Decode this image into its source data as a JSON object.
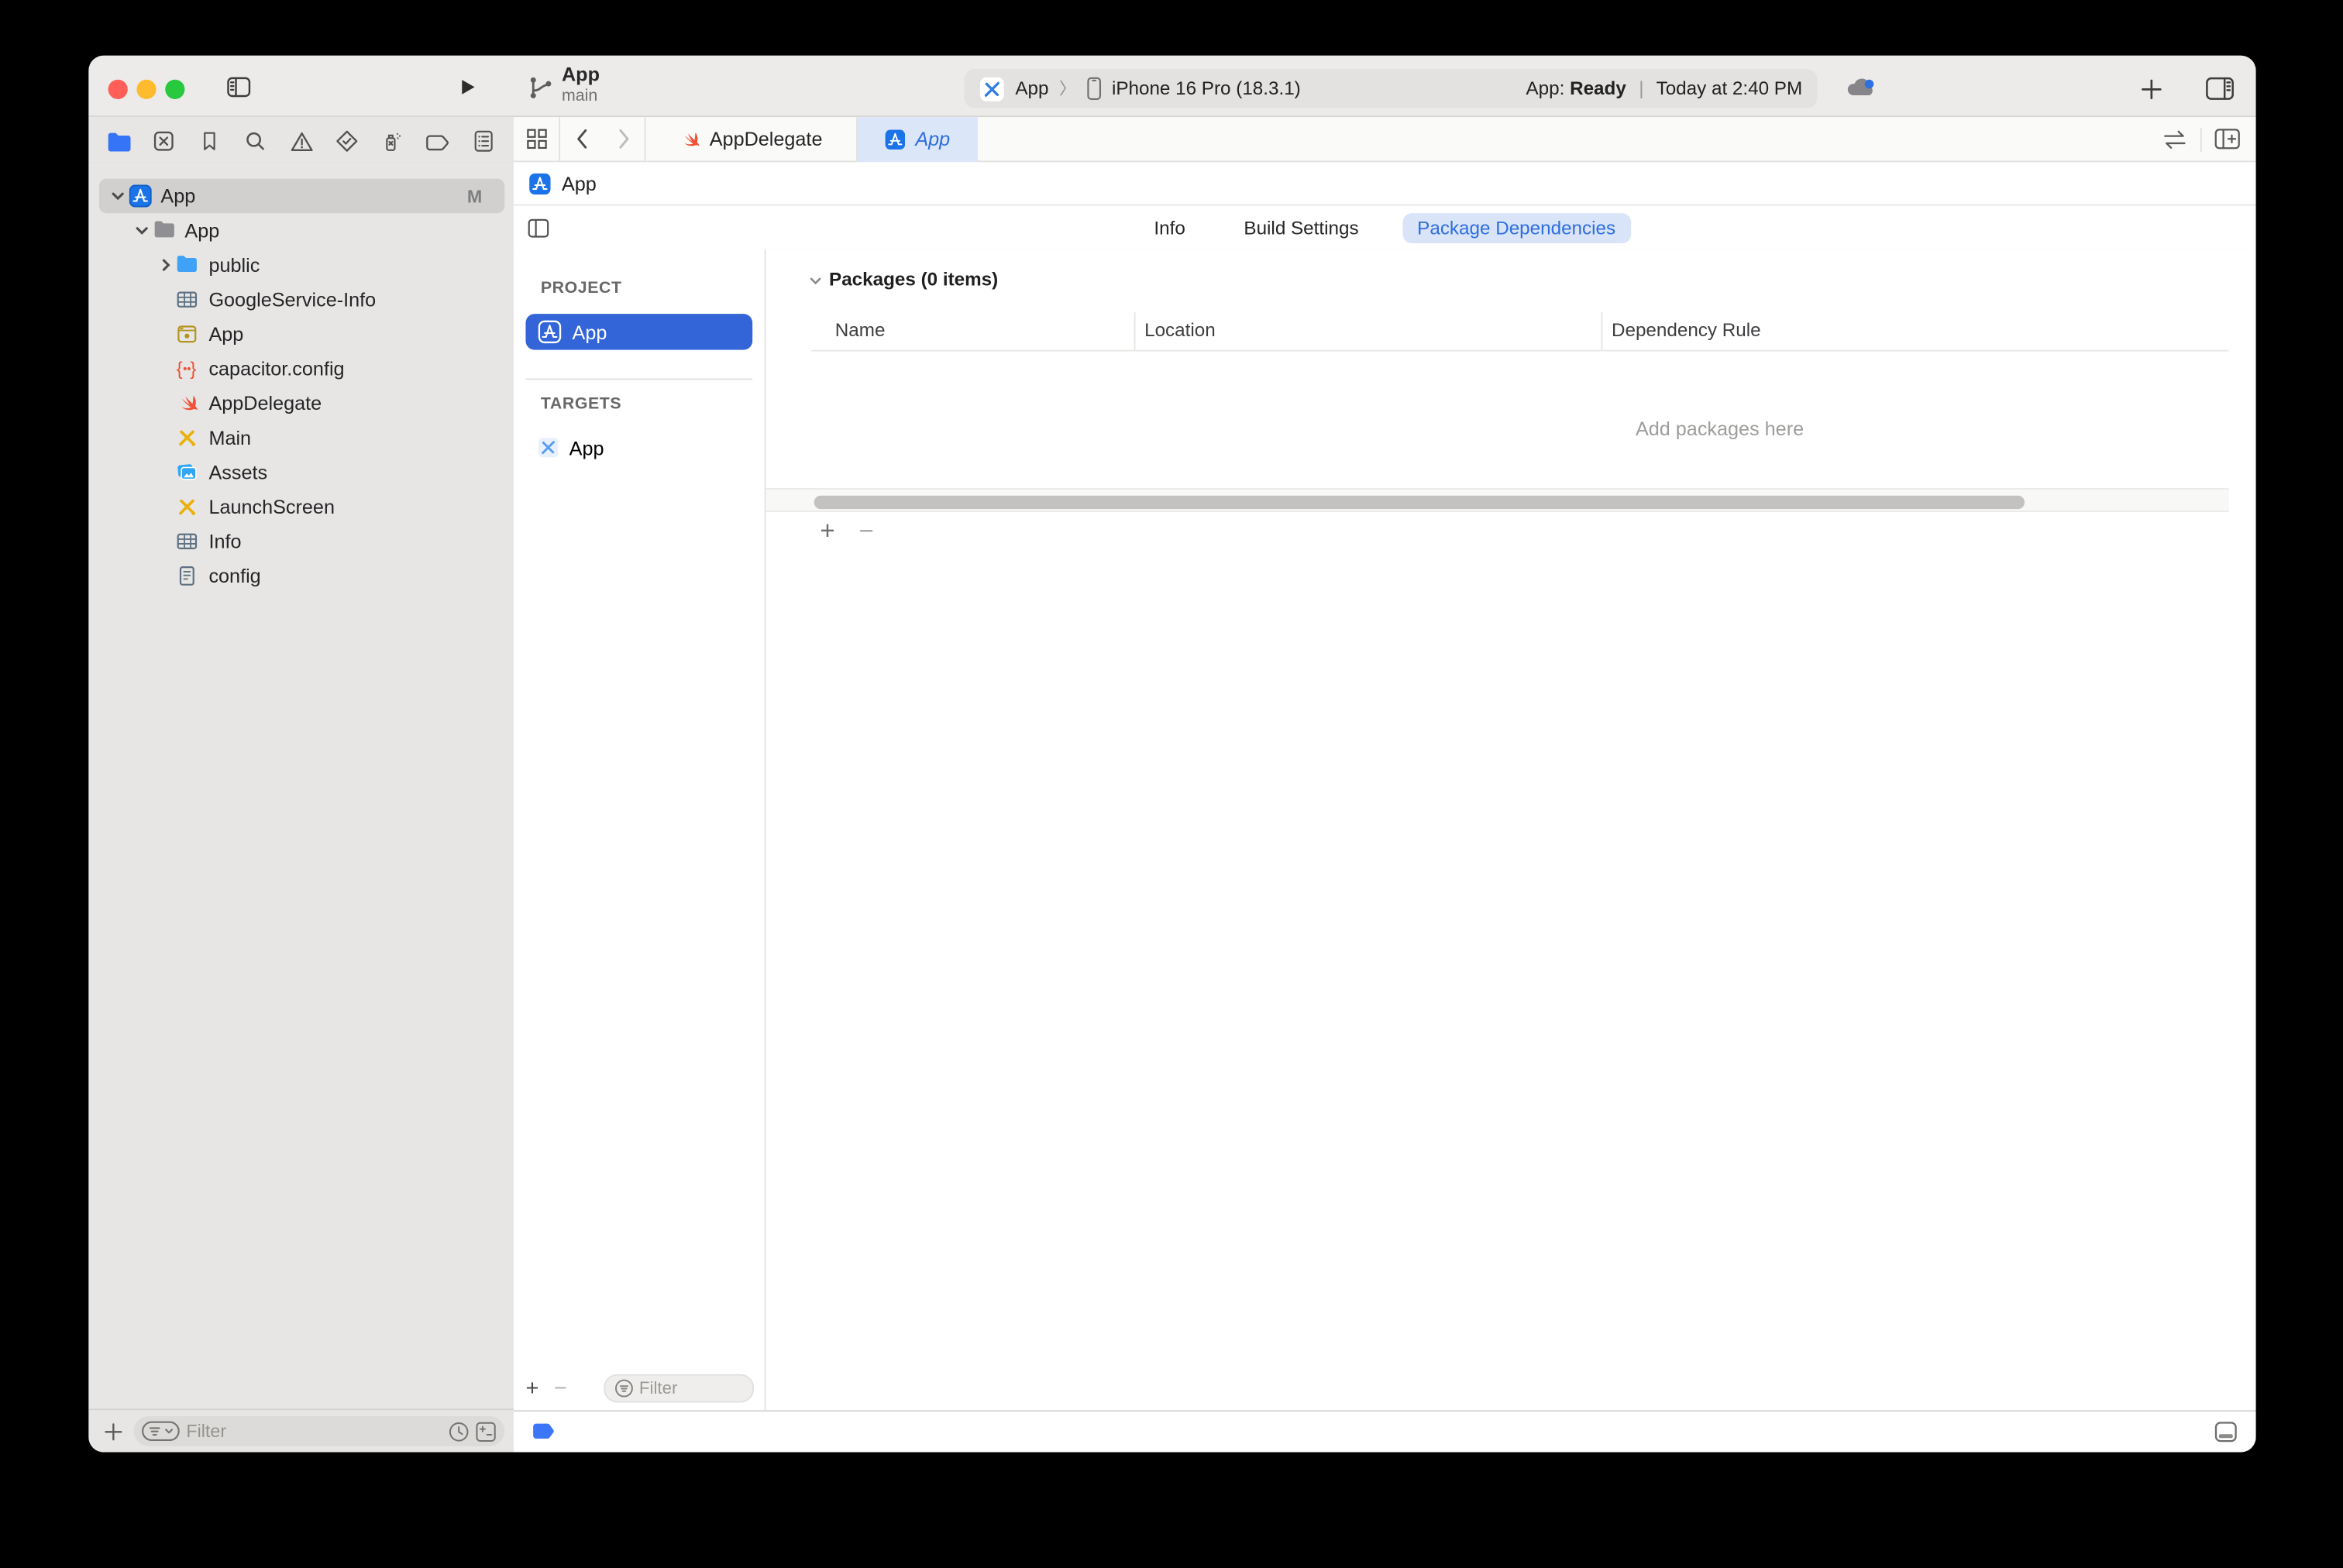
{
  "toolbar": {
    "branch": {
      "title": "App",
      "subtitle": "main"
    },
    "scheme": {
      "project": "App",
      "separator": "〉",
      "destination": "iPhone 16 Pro (18.3.1)"
    },
    "status": {
      "prefix": "App:",
      "state": "Ready",
      "divider": "|",
      "time": "Today at 2:40 PM"
    }
  },
  "navigator": {
    "tree": [
      {
        "label": "App",
        "badge": "M"
      },
      {
        "label": "App"
      },
      {
        "label": "public"
      },
      {
        "label": "GoogleService-Info"
      },
      {
        "label": "App"
      },
      {
        "label": "capacitor.config"
      },
      {
        "label": "AppDelegate"
      },
      {
        "label": "Main"
      },
      {
        "label": "Assets"
      },
      {
        "label": "LaunchScreen"
      },
      {
        "label": "Info"
      },
      {
        "label": "config"
      }
    ],
    "filter_placeholder": "Filter"
  },
  "editor": {
    "tabs": [
      {
        "label": "AppDelegate"
      },
      {
        "label": "App"
      }
    ],
    "jumpbar": {
      "label": "App"
    },
    "config_tabs": [
      {
        "label": "Info"
      },
      {
        "label": "Build Settings"
      },
      {
        "label": "Package Dependencies"
      }
    ],
    "project_panel": {
      "project_header": "PROJECT",
      "project_name": "App",
      "targets_header": "TARGETS",
      "target_name": "App",
      "filter_placeholder": "Filter"
    },
    "packages": {
      "section_title": "Packages (0 items)",
      "columns": [
        "Name",
        "Location",
        "Dependency Rule"
      ],
      "rows": [],
      "empty_text": "Add packages here"
    }
  },
  "colors": {
    "accent_blue": "#3365d9",
    "tab_active_bg": "#dbe7f9",
    "tab_active_text": "#2e6ee0",
    "traffic_red": "#ff5f57",
    "traffic_yellow": "#febb2e",
    "traffic_green": "#28c83f",
    "swift_orange": "#f05138",
    "storyboard_yellow": "#e8b10e",
    "folder_blue": "#3fa2f7"
  }
}
